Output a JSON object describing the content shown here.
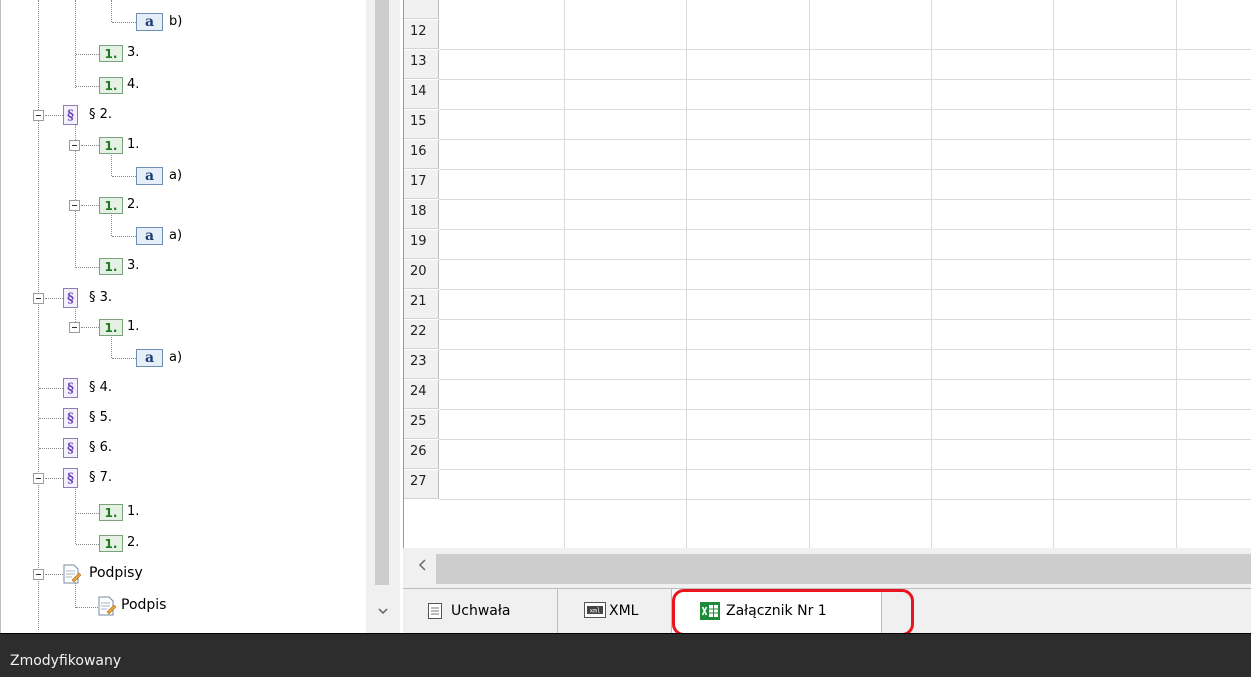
{
  "tree": {
    "items": [
      {
        "icon": "letter-icon",
        "glyph": "a",
        "label": "b)"
      },
      {
        "icon": "number-icon",
        "glyph": "1.",
        "label": "3."
      },
      {
        "icon": "number-icon",
        "glyph": "1.",
        "label": "4."
      },
      {
        "icon": "paragraph-icon",
        "glyph": "§",
        "label": "§ 2."
      },
      {
        "icon": "number-icon",
        "glyph": "1.",
        "label": "1."
      },
      {
        "icon": "letter-icon",
        "glyph": "a",
        "label": "a)"
      },
      {
        "icon": "number-icon",
        "glyph": "1.",
        "label": "2."
      },
      {
        "icon": "letter-icon",
        "glyph": "a",
        "label": "a)"
      },
      {
        "icon": "number-icon",
        "glyph": "1.",
        "label": "3."
      },
      {
        "icon": "paragraph-icon",
        "glyph": "§",
        "label": "§ 3."
      },
      {
        "icon": "number-icon",
        "glyph": "1.",
        "label": "1."
      },
      {
        "icon": "letter-icon",
        "glyph": "a",
        "label": "a)"
      },
      {
        "icon": "paragraph-icon",
        "glyph": "§",
        "label": "§ 4."
      },
      {
        "icon": "paragraph-icon",
        "glyph": "§",
        "label": "§ 5."
      },
      {
        "icon": "paragraph-icon",
        "glyph": "§",
        "label": "§ 6."
      },
      {
        "icon": "paragraph-icon",
        "glyph": "§",
        "label": "§ 7."
      },
      {
        "icon": "number-icon",
        "glyph": "1.",
        "label": "1."
      },
      {
        "icon": "number-icon",
        "glyph": "1.",
        "label": "2."
      },
      {
        "icon": "document-pen-icon",
        "glyph": "",
        "label": "Podpisy"
      },
      {
        "icon": "document-pen-icon",
        "glyph": "",
        "label": "Podpis"
      }
    ],
    "scroll_down_icon": "chevron-down-icon"
  },
  "grid": {
    "row_numbers": [
      "12",
      "13",
      "14",
      "15",
      "16",
      "17",
      "18",
      "19",
      "20",
      "21",
      "22",
      "23",
      "24",
      "25",
      "26",
      "27"
    ],
    "scroll_left_icon": "chevron-left-icon"
  },
  "tabs": [
    {
      "label": "Uchwała",
      "icon": "document-icon"
    },
    {
      "label": "XML",
      "icon": "xml-icon"
    },
    {
      "label": "Załącznik Nr 1",
      "icon": "spreadsheet-icon",
      "active": true
    }
  ],
  "status": {
    "text": "Zmodyfikowany"
  },
  "colors": {
    "highlight": "#e8141e",
    "status_bg": "#2d2d2d",
    "paragraph": "#6a44b8",
    "number": "#1f7a1f",
    "letter": "#1c3f73"
  }
}
